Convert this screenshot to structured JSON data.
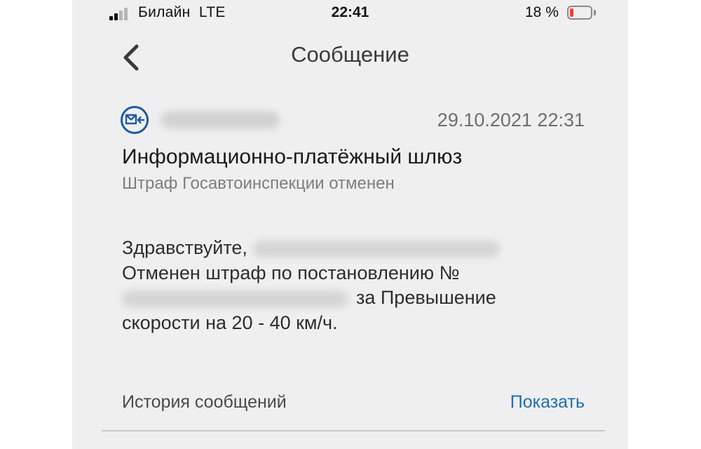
{
  "status_bar": {
    "carrier": "Билайн",
    "network": "LTE",
    "time": "22:41",
    "battery_text": "18 %",
    "battery_level": 0.18,
    "signal_bars_filled": 2,
    "signal_bars_total": 4
  },
  "nav": {
    "title": "Сообщение"
  },
  "message": {
    "date": "29.10.2021 22:31",
    "title": "Информационно-платёжный шлюз",
    "subtitle": "Штраф Госавтоинспекции отменен",
    "body": {
      "greeting": "Здравствуйте,",
      "line2": "Отменен штраф по постановлению №",
      "line3_suffix": "за Превышение",
      "line4": "скорости на 20 - 40 км/ч."
    }
  },
  "history": {
    "label": "История сообщений",
    "action_label": "Показать"
  },
  "colors": {
    "accent": "#1b6fb0",
    "battery_low": "#ff3b30",
    "icon": "#1e5aa8"
  },
  "icons": {
    "back": "chevron-left-icon",
    "message_type": "envelope-incoming-icon"
  }
}
